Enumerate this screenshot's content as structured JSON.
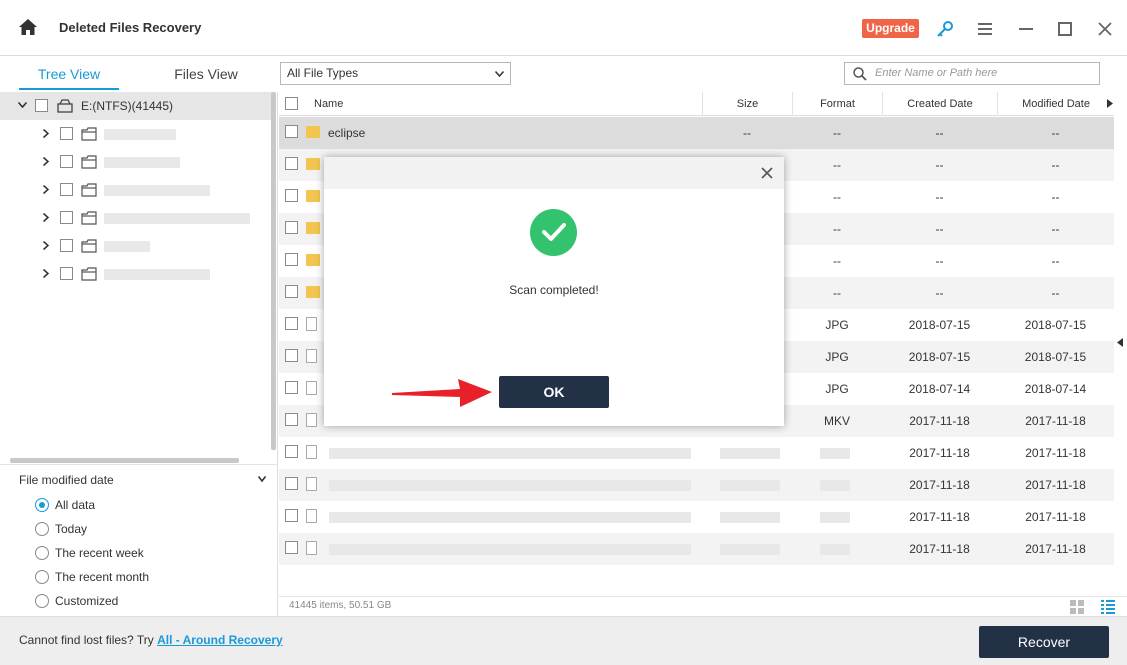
{
  "app": {
    "title": "Deleted Files Recovery",
    "upgrade_label": "Upgrade"
  },
  "window_controls": {
    "key_icon": "key-icon",
    "menu_icon": "menu-icon",
    "minimize": "minimize-icon",
    "maximize": "maximize-icon",
    "close": "close-icon"
  },
  "tabs": [
    {
      "label": "Tree View",
      "active": true
    },
    {
      "label": "Files View",
      "active": false
    }
  ],
  "file_type_filter": {
    "value": "All File Types"
  },
  "search": {
    "placeholder": "Enter Name or Path here"
  },
  "tree": {
    "drive_label": "E:(NTFS)(41445)"
  },
  "filter": {
    "title": "File modified date",
    "options": [
      {
        "label": "All data",
        "selected": true
      },
      {
        "label": "Today",
        "selected": false
      },
      {
        "label": "The recent week",
        "selected": false
      },
      {
        "label": "The recent month",
        "selected": false
      },
      {
        "label": "Customized",
        "selected": false
      }
    ]
  },
  "table": {
    "columns": [
      "Name",
      "Size",
      "Format",
      "Created Date",
      "Modified Date"
    ],
    "rows": [
      {
        "name": "eclipse",
        "size": "--",
        "format": "--",
        "created": "--",
        "modified": "--",
        "type": "folder"
      },
      {
        "name": "",
        "size": "",
        "format": "--",
        "created": "--",
        "modified": "--",
        "type": "folder"
      },
      {
        "name": "",
        "size": "",
        "format": "--",
        "created": "--",
        "modified": "--",
        "type": "folder"
      },
      {
        "name": "",
        "size": "",
        "format": "--",
        "created": "--",
        "modified": "--",
        "type": "folder"
      },
      {
        "name": "",
        "size": "",
        "format": "--",
        "created": "--",
        "modified": "--",
        "type": "folder"
      },
      {
        "name": "",
        "size": "",
        "format": "--",
        "created": "--",
        "modified": "--",
        "type": "folder"
      },
      {
        "name": "",
        "size": "",
        "format": "JPG",
        "created": "2018-07-15",
        "modified": "2018-07-15",
        "type": "file"
      },
      {
        "name": "",
        "size": "",
        "format": "JPG",
        "created": "2018-07-15",
        "modified": "2018-07-15",
        "type": "file"
      },
      {
        "name": "",
        "size": "",
        "format": "JPG",
        "created": "2018-07-14",
        "modified": "2018-07-14",
        "type": "file"
      },
      {
        "name": "",
        "size": "",
        "format": "MKV",
        "created": "2017-11-18",
        "modified": "2017-11-18",
        "type": "file"
      },
      {
        "name": "",
        "size": "",
        "format": "",
        "created": "2017-11-18",
        "modified": "2017-11-18",
        "type": "file"
      },
      {
        "name": "",
        "size": "",
        "format": "",
        "created": "2017-11-18",
        "modified": "2017-11-18",
        "type": "file"
      },
      {
        "name": "",
        "size": "",
        "format": "",
        "created": "2017-11-18",
        "modified": "2017-11-18",
        "type": "file"
      },
      {
        "name": "",
        "size": "",
        "format": "",
        "created": "2017-11-18",
        "modified": "2017-11-18",
        "type": "file"
      }
    ]
  },
  "status": {
    "text": "41445 items, 50.51 GB"
  },
  "bottom": {
    "prompt": "Cannot find lost files? Try ",
    "link": "All - Around Recovery",
    "recover_label": "Recover"
  },
  "dialog": {
    "message": "Scan completed!",
    "ok_label": "OK"
  },
  "colors": {
    "accent": "#1a9ad6",
    "dark_button": "#233146",
    "upgrade": "#f06548",
    "success": "#33c26e",
    "arrow": "#e8202a"
  }
}
